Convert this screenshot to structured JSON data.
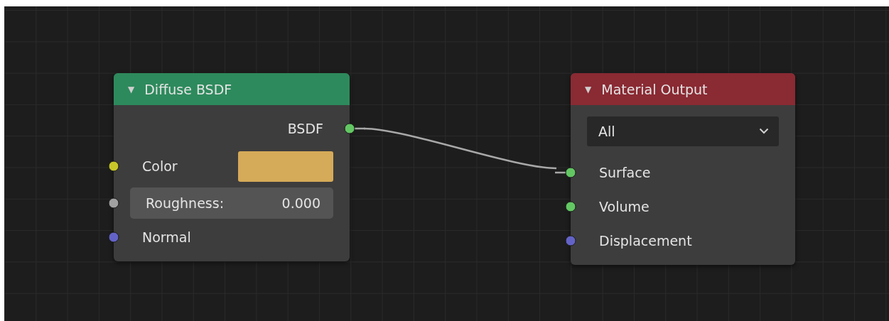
{
  "nodes": [
    {
      "title": "Diffuse BSDF",
      "toggle": "▼",
      "color": "#2d8a5c",
      "rows": [
        {
          "kind": "output",
          "label": "BSDF",
          "socket": {
            "color": "#63c763",
            "linked": true
          }
        },
        {
          "kind": "color",
          "label": "Color",
          "socket": {
            "color": "#c7c729",
            "linked": false
          },
          "swatch": {
            "color": "#d5aa58"
          }
        },
        {
          "kind": "number",
          "label": "Roughness:",
          "value": "0.000",
          "socket": {
            "color": "#a1a1a1",
            "linked": false
          }
        },
        {
          "kind": "input",
          "label": "Normal",
          "socket": {
            "color": "#6363c7",
            "linked": false
          }
        }
      ]
    },
    {
      "title": "Material Output",
      "toggle": "▼",
      "color": "#8a2a33",
      "rows": [
        {
          "kind": "dropdown",
          "value": "All"
        },
        {
          "kind": "input",
          "label": "Surface",
          "socket": {
            "color": "#63c763",
            "linked": true
          }
        },
        {
          "kind": "input",
          "label": "Volume",
          "socket": {
            "color": "#63c763",
            "linked": false
          }
        },
        {
          "kind": "input",
          "label": "Displacement",
          "socket": {
            "color": "#6363c7",
            "linked": false
          }
        }
      ]
    }
  ]
}
